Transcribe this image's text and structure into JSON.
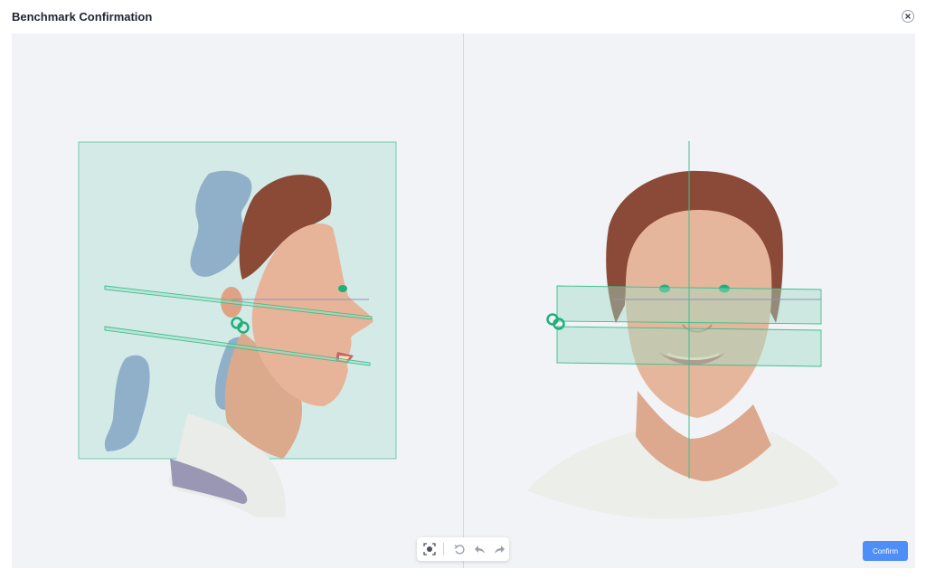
{
  "dialog": {
    "title": "Benchmark Confirmation"
  },
  "actions": {
    "confirm_label": "Confirm"
  },
  "toolbar": {
    "tools": [
      "reset-view-icon",
      "rotate-reset-icon",
      "undo-icon",
      "redo-icon"
    ]
  },
  "colors": {
    "accent": "#4f8df7",
    "plane": "#9edbc6",
    "plane_edge": "#3fbf8c",
    "marker": "#1fb07a",
    "viewport_bg": "#f2f3f7"
  }
}
